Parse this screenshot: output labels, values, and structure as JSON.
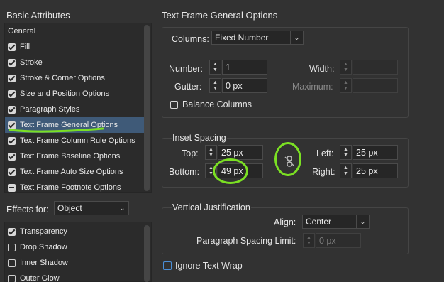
{
  "left": {
    "title": "Basic Attributes",
    "items": [
      {
        "label": "General",
        "check": "none"
      },
      {
        "label": "Fill",
        "check": "checked"
      },
      {
        "label": "Stroke",
        "check": "checked"
      },
      {
        "label": "Stroke & Corner Options",
        "check": "checked"
      },
      {
        "label": "Size and Position Options",
        "check": "checked"
      },
      {
        "label": "Paragraph Styles",
        "check": "checked"
      },
      {
        "label": "Text Frame General Options",
        "check": "checked",
        "selected": true
      },
      {
        "label": "Text Frame Column Rule Options",
        "check": "checked"
      },
      {
        "label": "Text Frame Baseline Options",
        "check": "checked"
      },
      {
        "label": "Text Frame Auto Size Options",
        "check": "checked"
      },
      {
        "label": "Text Frame Footnote Options",
        "check": "mixed"
      }
    ],
    "effects_label": "Effects for:",
    "effects_value": "Object",
    "effects": [
      {
        "label": "Transparency",
        "check": "checked"
      },
      {
        "label": "Drop Shadow",
        "check": "empty"
      },
      {
        "label": "Inner Shadow",
        "check": "empty"
      },
      {
        "label": "Outer Glow",
        "check": "empty"
      }
    ]
  },
  "right": {
    "title": "Text Frame General Options",
    "columns": {
      "label": "Columns:",
      "value": "Fixed Number",
      "number_label": "Number:",
      "number_value": "1",
      "gutter_label": "Gutter:",
      "gutter_value": "0 px",
      "width_label": "Width:",
      "width_value": "",
      "maximum_label": "Maximum:",
      "maximum_value": "",
      "balance_label": "Balance Columns"
    },
    "inset": {
      "title": "Inset Spacing",
      "top_label": "Top:",
      "top_value": "25 px",
      "bottom_label": "Bottom:",
      "bottom_value": "49 px",
      "left_label": "Left:",
      "left_value": "25 px",
      "right_label": "Right:",
      "right_value": "25 px"
    },
    "vjust": {
      "title": "Vertical Justification",
      "align_label": "Align:",
      "align_value": "Center",
      "psl_label": "Paragraph Spacing Limit:",
      "psl_value": "0 px"
    },
    "ignore_wrap_label": "Ignore Text Wrap"
  },
  "colors": {
    "selection": "#3f5a78",
    "annotation": "#7be023",
    "background": "#323232"
  },
  "icons": {
    "link": "unlink-chain-icon",
    "spinner": "stepper-icon",
    "dropdown": "chevron-down-icon"
  }
}
